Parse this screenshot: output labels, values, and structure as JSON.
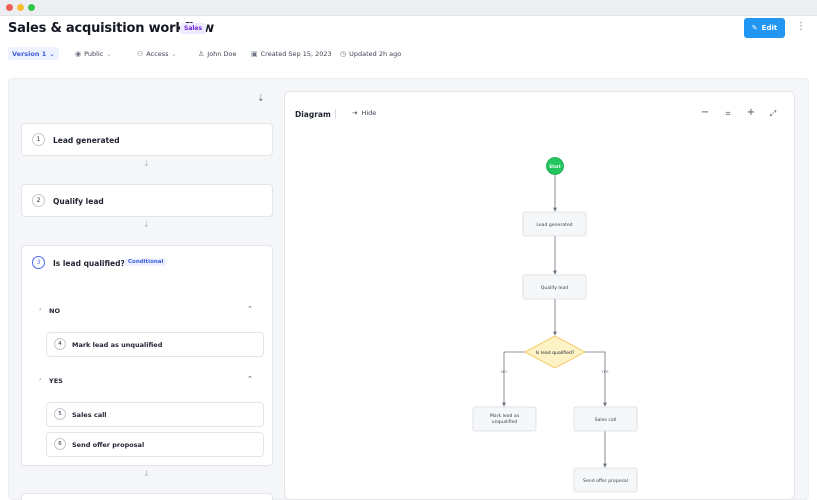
{
  "header": {
    "title": "Sales & acquisition workflow",
    "tag": "Sales",
    "edit_label": "Edit"
  },
  "meta": {
    "version": "Version 1",
    "visibility": "Public",
    "access": "Access",
    "owner": "John Doe",
    "created": "Created Sep 15, 2023",
    "updated": "Updated 2h ago"
  },
  "steps": [
    {
      "number": "1",
      "label": "Lead generated"
    },
    {
      "number": "2",
      "label": "Qualify lead"
    },
    {
      "number": "3",
      "label": "Is lead qualified?",
      "badge": "Conditional"
    }
  ],
  "branches": {
    "no": {
      "label": "NO",
      "steps": [
        {
          "number": "4",
          "label": "Mark lead as unqualified"
        }
      ]
    },
    "yes": {
      "label": "YES",
      "steps": [
        {
          "number": "5",
          "label": "Sales call"
        },
        {
          "number": "6",
          "label": "Send offer proposal"
        }
      ]
    }
  },
  "diagram": {
    "title": "Diagram",
    "hide_label": "Hide",
    "nodes": {
      "start": "Start",
      "lead_generated": "Lead generated",
      "qualify_lead": "Qualify lead",
      "decision": "Is lead qualified?",
      "no_label": "NO",
      "yes_label": "YES",
      "unqualified_line1": "Mark lead as",
      "unqualified_line2": "unqualified",
      "sales_call": "Sales call",
      "offer": "Send offer proposal"
    }
  },
  "icons": {
    "sort": "sort-icon",
    "zoom_out": "minus-icon",
    "fit": "fit-view-icon",
    "zoom_in": "plus-icon",
    "fullscreen": "fullscreen-icon"
  },
  "colors": {
    "accent": "#2196f3",
    "start_node": "#22c55e",
    "decision_fill": "#fef3c7",
    "decision_stroke": "#f5c451",
    "tag_bg": "#ede9fe",
    "tag_text": "#6d28d9"
  }
}
